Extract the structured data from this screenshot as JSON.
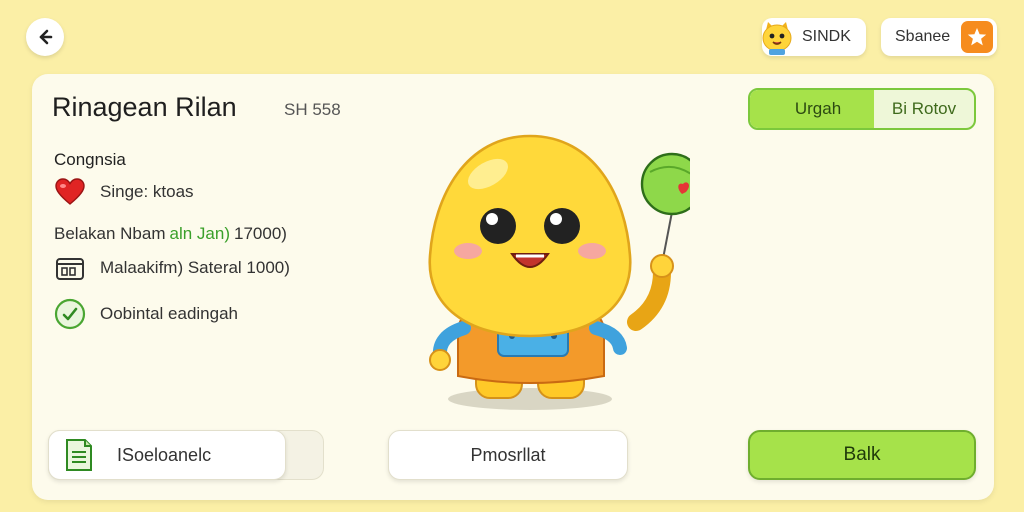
{
  "header": {
    "sync_label": "SINDK",
    "share_label": "Sbanee"
  },
  "card": {
    "title": "Rinagean Rilan",
    "subtitle": "SH 558",
    "toggle": {
      "option_a": "Urgah",
      "option_b": "Bi Rotov"
    },
    "section_label": "Congnsia",
    "rows": [
      {
        "icon": "heart-icon",
        "text": "Singe: ktoas"
      },
      {
        "prefix": "Belakan Nbam",
        "highlight": "aln Jan)",
        "suffix": "17000)"
      },
      {
        "icon": "wallet-icon",
        "text": "Malaakifm) Sateral 1000)"
      },
      {
        "icon": "check-circle-icon",
        "text": "Oobintal eadingah"
      }
    ],
    "buttons": {
      "doc_label": "ISoeloanelc",
      "middle_label": "Pmosrllat",
      "primary_label": "Balk"
    }
  },
  "colors": {
    "background": "#fbefa6",
    "card": "#fdfbec",
    "accent_green": "#a6e24a",
    "accent_orange": "#f68c1e",
    "mascot_yellow": "#ffd93a"
  }
}
